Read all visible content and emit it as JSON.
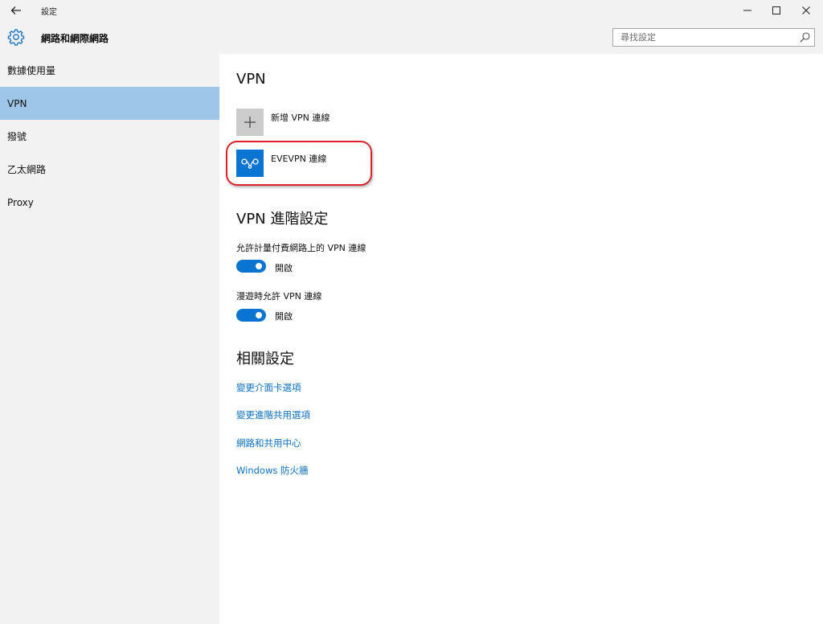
{
  "titlebar": {
    "app_title": "設定"
  },
  "header": {
    "section_title": "網路和網際網路"
  },
  "search": {
    "placeholder": "尋找設定"
  },
  "sidebar": {
    "items": [
      {
        "label": "數據使用量",
        "active": false
      },
      {
        "label": "VPN",
        "active": true
      },
      {
        "label": "撥號",
        "active": false
      },
      {
        "label": "乙太網路",
        "active": false
      },
      {
        "label": "Proxy",
        "active": false
      }
    ]
  },
  "main": {
    "vpn_heading": "VPN",
    "add_vpn_label": "新增 VPN 連線",
    "vpn_connections": [
      {
        "name": "EVEVPN 連線"
      }
    ],
    "advanced_heading": "VPN 進階設定",
    "metered_label": "允許計量付費網路上的 VPN 連線",
    "metered_state": "開啟",
    "roaming_label": "漫遊時允許 VPN 連線",
    "roaming_state": "開啟",
    "related_heading": "相關設定",
    "related_links": [
      "變更介面卡選項",
      "變更進階共用選項",
      "網路和共用中心",
      "Windows 防火牆"
    ]
  },
  "colors": {
    "accent": "#0a74d3",
    "sidebar_selected": "#9ec6e8",
    "chrome_bg": "#f2f2f2",
    "highlight_annotation": "#d9252a"
  },
  "icons": {
    "back": "arrow-left-icon",
    "settings": "gear-icon",
    "search": "search-icon",
    "add": "plus-icon",
    "vpn": "vpn-connection-icon",
    "minimize": "minimize-icon",
    "maximize": "maximize-icon",
    "close": "close-icon"
  }
}
